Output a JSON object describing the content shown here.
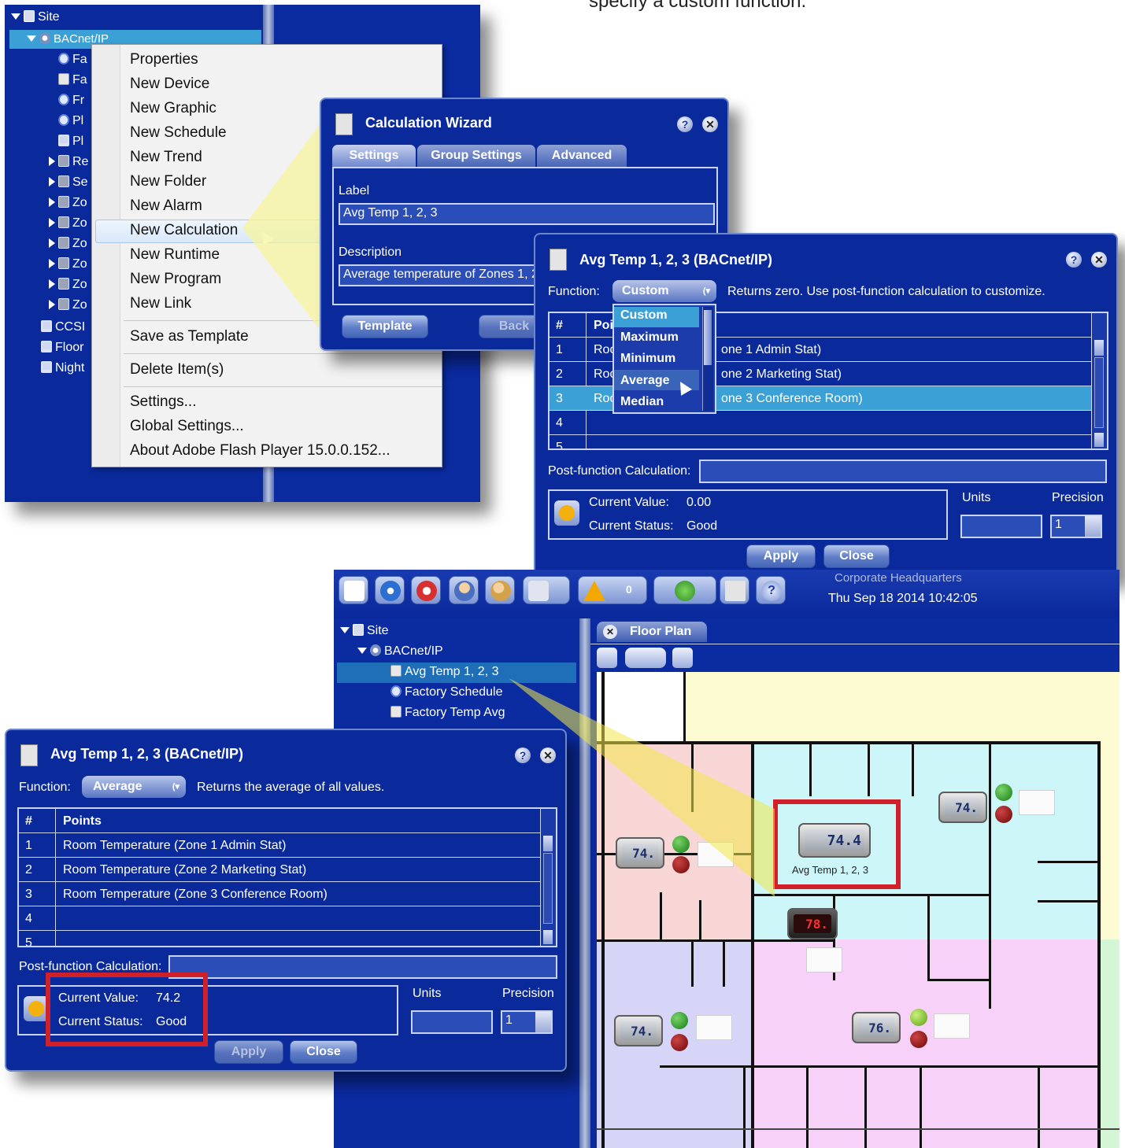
{
  "caption_fragment": "specify a custom function.",
  "tree_top": {
    "site": "Site",
    "bacnet": "BACnet/IP",
    "children": [
      "Fa",
      "Fa",
      "Fr",
      "Pl",
      "Pl",
      "Re",
      "Se",
      "Zo",
      "Zo",
      "Zo",
      "Zo",
      "Zo",
      "Zo"
    ],
    "bottom": [
      "CCSI",
      "Floor",
      "Night"
    ]
  },
  "context_menu": {
    "items": [
      "Properties",
      "New Device",
      "New Graphic",
      "New Schedule",
      "New Trend",
      "New Folder",
      "New Alarm",
      "New Calculation",
      "New Runtime",
      "New Program",
      "New Link",
      "Save as Template",
      "Delete Item(s)",
      "Settings...",
      "Global Settings...",
      "About Adobe Flash Player 15.0.0.152..."
    ]
  },
  "wizard": {
    "title": "Calculation Wizard",
    "tabs": [
      "Settings",
      "Group Settings",
      "Advanced"
    ],
    "label_caption": "Label",
    "label_value": "Avg Temp 1, 2, 3",
    "desc_caption": "Description",
    "desc_value": "Average temperature of Zones 1, 2",
    "template_btn": "Template",
    "back_btn": "Back"
  },
  "dialog1": {
    "title": "Avg Temp 1, 2, 3 (BACnet/IP)",
    "function_label": "Function:",
    "function_value": "Custom",
    "function_desc": "Returns zero. Use post-function calculation to customize.",
    "col_num": "#",
    "col_points": "Poi",
    "rows": [
      {
        "n": "1",
        "pre": "Roo",
        "post": "one 1 Admin Stat)"
      },
      {
        "n": "2",
        "pre": "Roo",
        "post": "one 2 Marketing Stat)"
      },
      {
        "n": "3",
        "pre": "Roo",
        "post": "one 3 Conference Room)"
      },
      {
        "n": "4",
        "pre": "",
        "post": ""
      },
      {
        "n": "5",
        "pre": "",
        "post": ""
      }
    ],
    "dropdown": [
      "Custom",
      "Maximum",
      "Minimum",
      "Average",
      "Median"
    ],
    "post_label": "Post-function Calculation:",
    "cv_label": "Current Value:",
    "cv_value": "0.00",
    "cs_label": "Current Status:",
    "cs_value": "Good",
    "units_label": "Units",
    "precision_label": "Precision",
    "precision_value": "1",
    "apply": "Apply",
    "close": "Close"
  },
  "app": {
    "alarm_count": "0",
    "org": "Corporate Headquarters",
    "datetime": "Thu Sep 18 2014 10:42:05",
    "tree": {
      "site": "Site",
      "bacnet": "BACnet/IP",
      "items": [
        "Avg Temp 1, 2, 3",
        "Factory Schedule",
        "Factory Temp Avg"
      ]
    },
    "floor_tab": "Floor Plan",
    "thermostats": {
      "t1": "74.",
      "t2": "74.4",
      "t3": "74.",
      "t4": "78.",
      "t5": "74.",
      "t6": "76."
    },
    "highlight_label": "Avg Temp 1, 2, 3"
  },
  "dialog2": {
    "title": "Avg Temp 1, 2, 3 (BACnet/IP)",
    "function_label": "Function:",
    "function_value": "Average",
    "function_desc": "Returns the average of all values.",
    "col_num": "#",
    "col_points": "Points",
    "rows": [
      {
        "n": "1",
        "p": "Room Temperature (Zone 1 Admin Stat)"
      },
      {
        "n": "2",
        "p": "Room Temperature (Zone 2 Marketing Stat)"
      },
      {
        "n": "3",
        "p": "Room Temperature (Zone 3 Conference Room)"
      },
      {
        "n": "4",
        "p": ""
      },
      {
        "n": "5",
        "p": ""
      }
    ],
    "post_label": "Post-function Calculation:",
    "cv_label": "Current Value:",
    "cv_value": "74.2",
    "cs_label": "Current Status:",
    "cs_value": "Good",
    "units_label": "Units",
    "precision_label": "Precision",
    "precision_value": "1",
    "apply": "Apply",
    "close": "Close"
  },
  "colors": {
    "panel_navy": "#0a2a9c",
    "highlight_red": "#d0202a",
    "selection_blue": "#3aa0d6"
  }
}
